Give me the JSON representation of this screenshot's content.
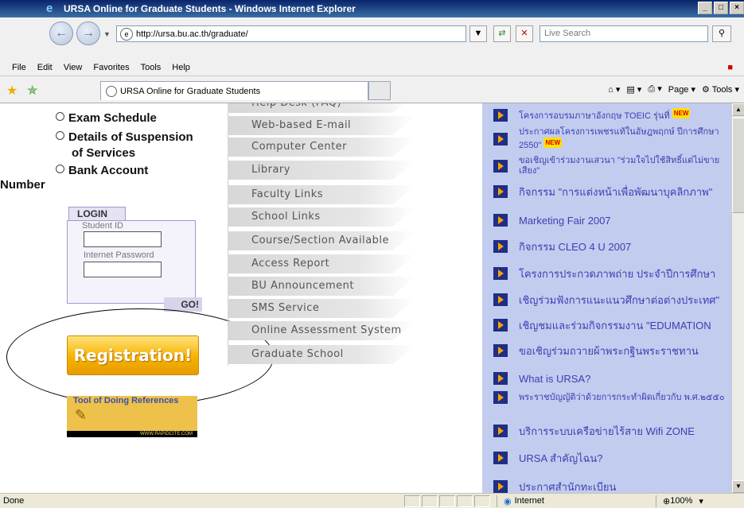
{
  "window": {
    "title": "URSA Online for Graduate Students - Windows Internet Explorer",
    "controls": [
      "_",
      "□",
      "×"
    ]
  },
  "addressbar": {
    "url": "http://ursa.bu.ac.th/graduate/",
    "search_placeholder": "Live Search"
  },
  "menu": [
    "File",
    "Edit",
    "View",
    "Favorites",
    "Tools",
    "Help"
  ],
  "tabs": [
    {
      "label": "URSA Online for Graduate Students"
    }
  ],
  "commandbar": {
    "page": "Page",
    "tools": "Tools"
  },
  "left_links": [
    {
      "label": "Exam Schedule"
    },
    {
      "label": "Details of Suspension"
    },
    {
      "label": "of Services"
    },
    {
      "label": "Bank Account"
    },
    {
      "label": "Number"
    }
  ],
  "login": {
    "title": "LOGIN",
    "student_id_label": "Student ID",
    "password_label": "Internet Password",
    "go": "GO!"
  },
  "registration_button": "Registration!",
  "references_banner": {
    "title": "Tool of Doing References",
    "footer": "WWW.RAPIDCITE.COM"
  },
  "middle_menu": [
    "Help Desk (FAQ)",
    "Web-based E-mail",
    "Computer Center",
    "Library",
    "Faculty Links",
    "School Links",
    "Course/Section Available",
    "Access Report",
    "BU Announcement",
    "SMS  Service",
    "Online Assessment System",
    "Graduate School"
  ],
  "news": [
    {
      "text": "โครงการอบรมภาษาอังกฤษ TOEIC รุ่นที่",
      "new": "NEW"
    },
    {
      "text": "ประกาศผลโครงการเพชรแท้ในอัษฎพฤกษ์ ปีการศึกษา 2550\"",
      "new": "NEW"
    },
    {
      "text": "ขอเชิญเข้าร่วมงานเสวนา \"ร่วมใจไปใช้สิทธิ์แต่ไม่ขายเสียง\""
    },
    {
      "text": "กิจกรรม \"การแต่งหน้าเพื่อพัฒนาบุคลิกภาพ\""
    },
    {
      "text": "Marketing Fair 2007"
    },
    {
      "text": "กิจกรรม CLEO 4 U 2007"
    },
    {
      "text": "โครงการประกวดภาพถ่าย ประจำปีการศึกษา"
    },
    {
      "text": "เชิญร่วมฟังการแนะแนวศึกษาต่อต่างประเทศ\""
    },
    {
      "text": "เชิญชมและร่วมกิจกรรมงาน \"EDUMATION"
    },
    {
      "text": "ขอเชิญร่วมถวายผ้าพระกฐินพระราชทาน"
    },
    {
      "text": "What is URSA?"
    },
    {
      "text": "พระราชบัญญัติว่าด้วยการกระทำผิดเกี่ยวกับ พ.ศ.๒๕๕๐"
    },
    {
      "text": "บริการระบบเครือข่ายไร้สาย Wifi ZONE"
    },
    {
      "text": "URSA สำคัญไฉน?"
    },
    {
      "text": "ประกาศสำนักทะเบียน"
    }
  ],
  "status": {
    "text": "Done",
    "zone": "Internet",
    "zoom": "100%"
  }
}
